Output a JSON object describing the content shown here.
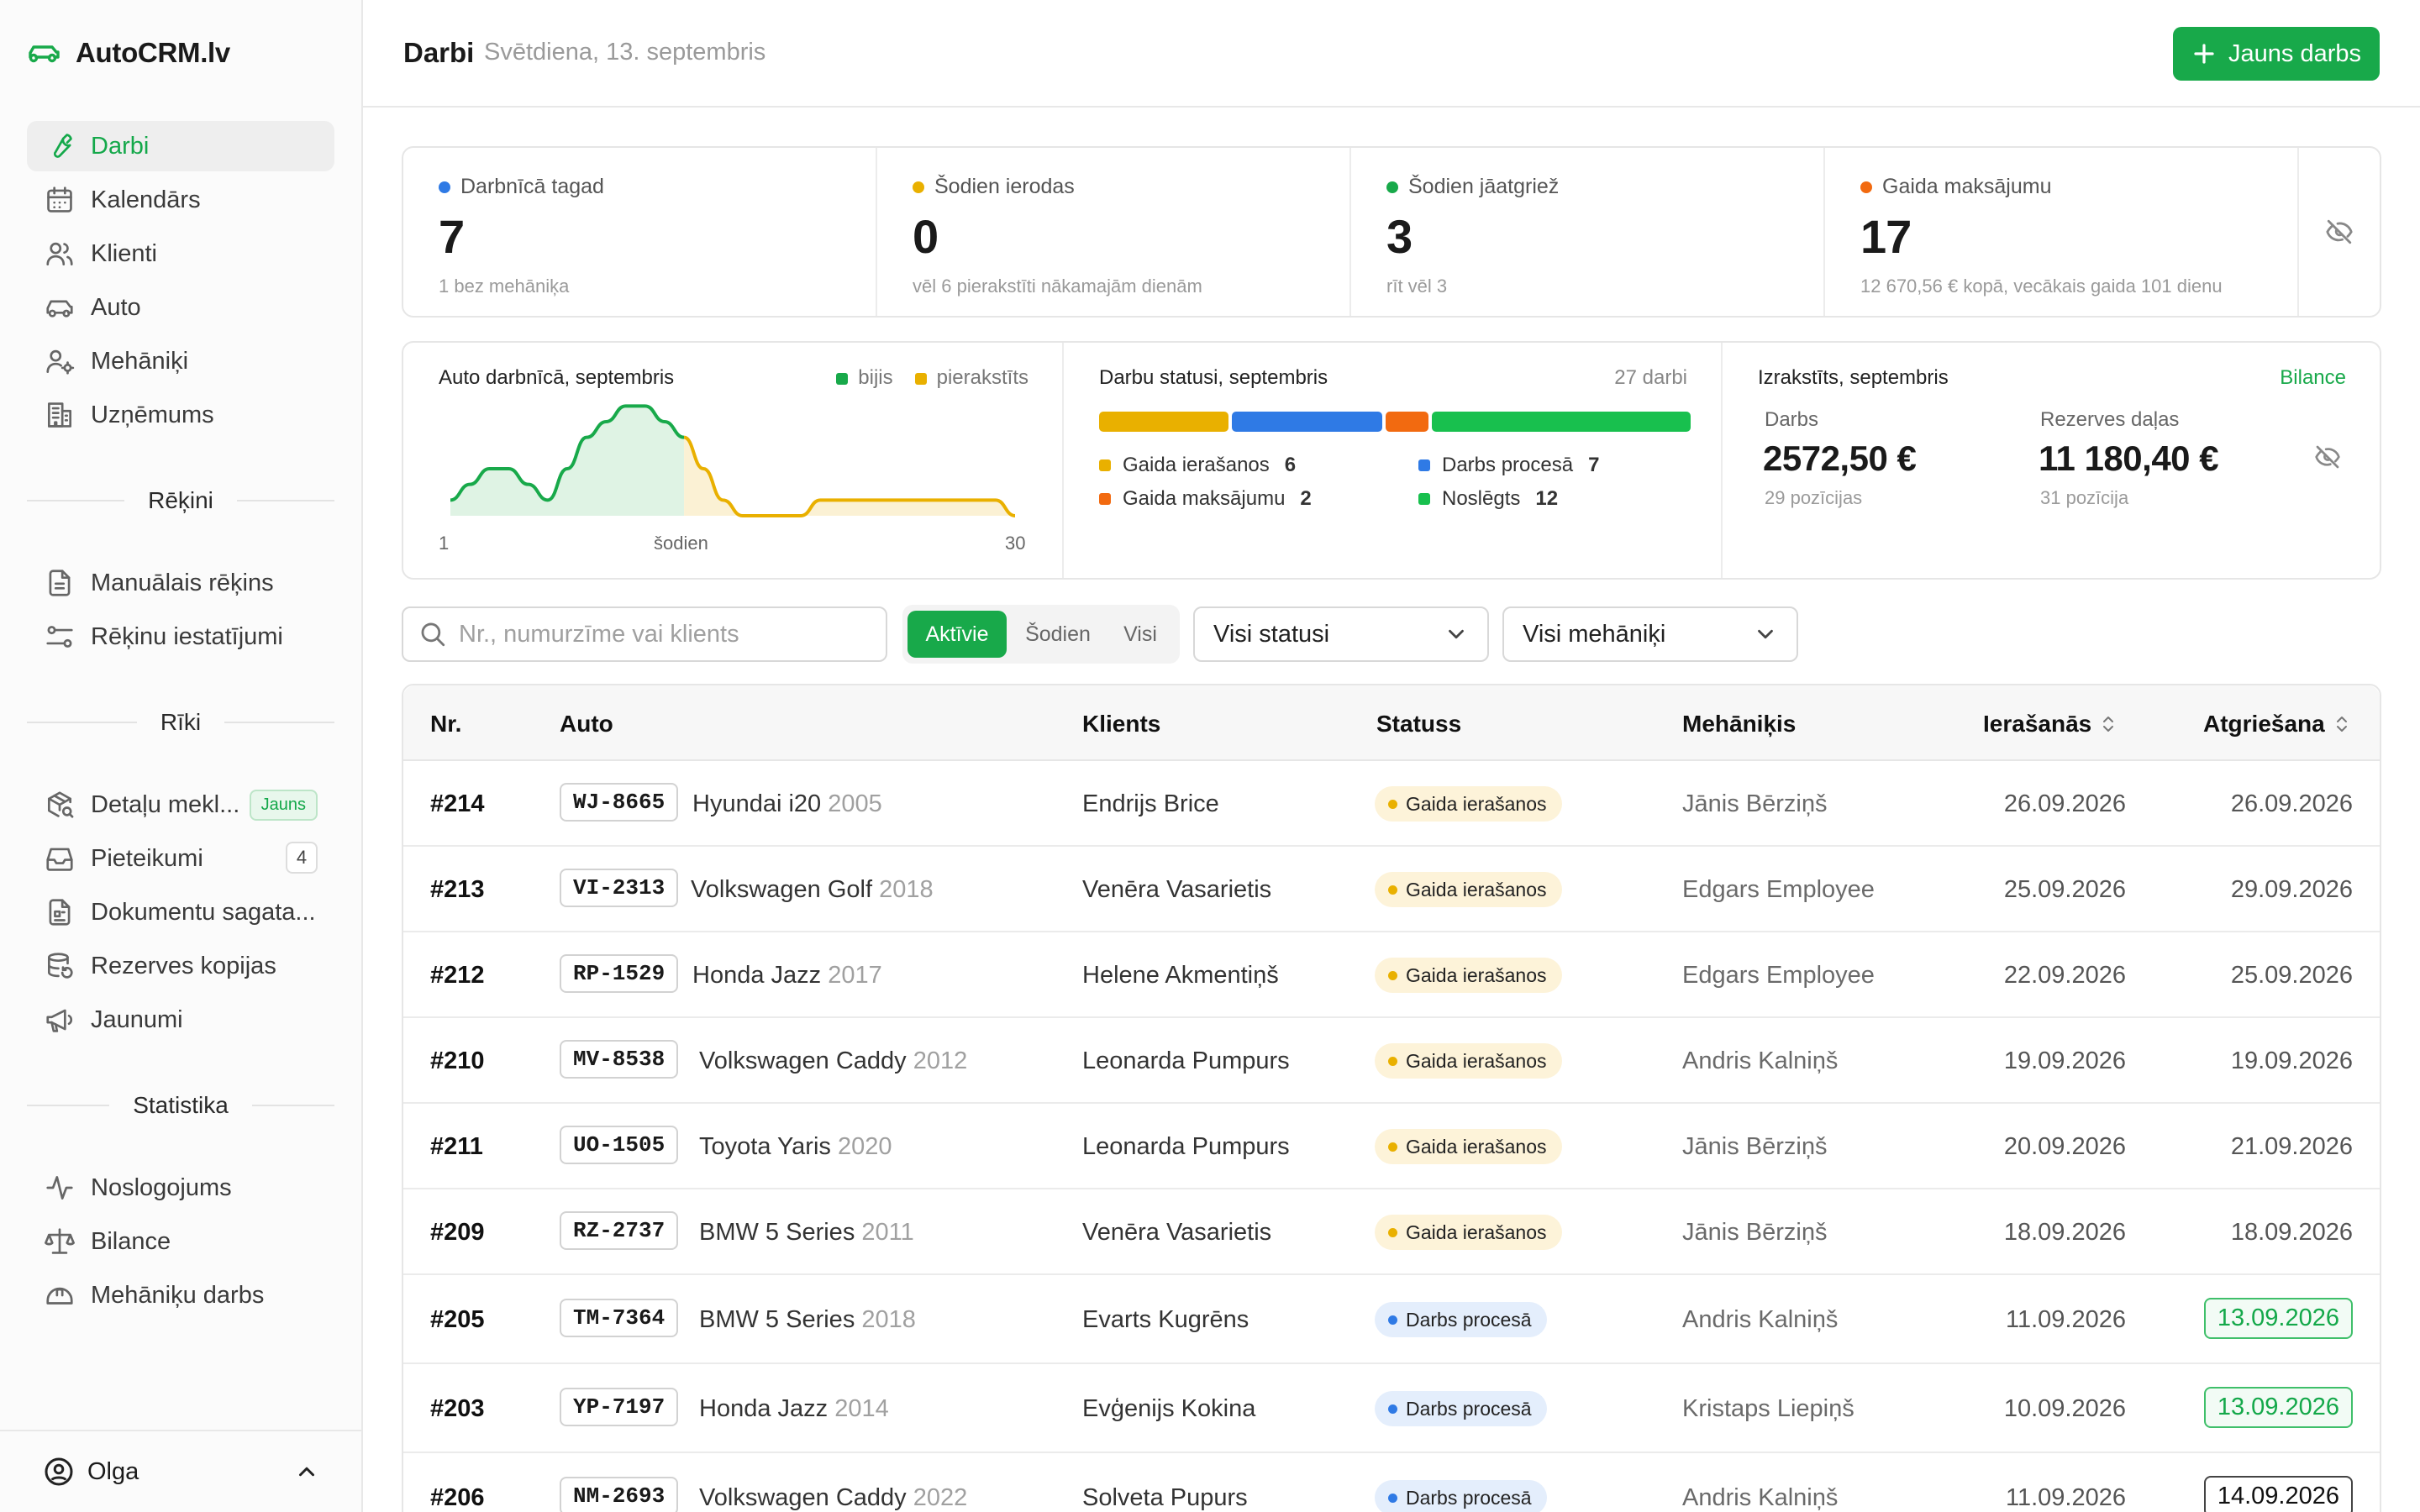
{
  "app": {
    "brand": "AutoCRM.lv"
  },
  "sidebar": {
    "main": [
      {
        "label": "Darbi",
        "icon": "wrench-icon",
        "active": true
      },
      {
        "label": "Kalendārs",
        "icon": "calendar-icon"
      },
      {
        "label": "Klienti",
        "icon": "users-icon"
      },
      {
        "label": "Auto",
        "icon": "car-icon"
      },
      {
        "label": "Mehāniķi",
        "icon": "mechanic-icon"
      },
      {
        "label": "Uzņēmums",
        "icon": "building-icon"
      }
    ],
    "sec_invoices": "Rēķini",
    "invoices": [
      {
        "label": "Manuālais rēķins",
        "icon": "document-icon"
      },
      {
        "label": "Rēķinu iestatījumi",
        "icon": "sliders-icon"
      }
    ],
    "sec_tools": "Rīki",
    "tools": [
      {
        "label": "Detaļu mekl...",
        "icon": "package-search-icon",
        "badge": "Jauns"
      },
      {
        "label": "Pieteikumi",
        "icon": "inbox-icon",
        "count": "4"
      },
      {
        "label": "Dokumentu sagata...",
        "icon": "file-template-icon"
      },
      {
        "label": "Rezerves kopijas",
        "icon": "database-backup-icon"
      },
      {
        "label": "Jaunumi",
        "icon": "megaphone-icon"
      }
    ],
    "sec_stats": "Statistika",
    "stats": [
      {
        "label": "Noslogojums",
        "icon": "activity-icon"
      },
      {
        "label": "Bilance",
        "icon": "scale-icon"
      },
      {
        "label": "Mehāniķu darbs",
        "icon": "helmet-icon"
      }
    ],
    "user": "Olga"
  },
  "header": {
    "title": "Darbi",
    "date": "Svētdiena, 13. septembris",
    "new_button": "Jauns darbs"
  },
  "stats": [
    {
      "label": "Darbnīcā tagad",
      "value": "7",
      "sub": "1 bez mehāniķa",
      "color": "#2f7ae5"
    },
    {
      "label": "Šodien ierodas",
      "value": "0",
      "sub": "vēl 6 pierakstīti nākamajām dienām",
      "color": "#e9b000"
    },
    {
      "label": "Šodien jāatgriež",
      "value": "3",
      "sub": "rīt vēl 3",
      "color": "#18a94a"
    },
    {
      "label": "Gaida maksājumu",
      "value": "17",
      "sub": "12 670,56 € kopā, vecākais gaida 101 dienu",
      "color": "#f26a10"
    }
  ],
  "chart_data": {
    "type": "area",
    "title": "Auto darbnīcā, septembris",
    "x_start_label": "1",
    "x_today_label": "šodien",
    "x_end_label": "30",
    "series": [
      {
        "name": "bijis",
        "color": "#18a94a",
        "x": [
          1,
          2,
          3,
          4,
          5,
          6,
          7,
          8,
          9,
          10,
          11,
          12,
          13
        ],
        "values": [
          1,
          2,
          3,
          3,
          2,
          1,
          3,
          5,
          6,
          7,
          7,
          6,
          5
        ]
      },
      {
        "name": "pierakstīts",
        "color": "#e9b000",
        "x": [
          13,
          14,
          15,
          16,
          17,
          18,
          19,
          20,
          21,
          22,
          23,
          24,
          25,
          26,
          27,
          28,
          29,
          30
        ],
        "values": [
          5,
          3,
          1,
          0,
          0,
          0,
          0,
          1,
          1,
          1,
          1,
          1,
          1,
          1,
          1,
          1,
          1,
          0
        ]
      }
    ],
    "ylim": [
      0,
      7.5
    ]
  },
  "status_panel": {
    "title": "Darbu statusi, septembris",
    "total": "27 darbi",
    "items": [
      {
        "label": "Gaida ierašanos",
        "count": "6",
        "value": 6,
        "color": "#e9b000"
      },
      {
        "label": "Darbs procesā",
        "count": "7",
        "value": 7,
        "color": "#2f7ae5"
      },
      {
        "label": "Gaida maksājumu",
        "count": "2",
        "value": 2,
        "color": "#f26a10"
      },
      {
        "label": "Noslēgts",
        "count": "12",
        "value": 12,
        "color": "#18c04e"
      }
    ]
  },
  "balance_panel": {
    "title": "Izrakstīts, septembris",
    "link": "Bilance",
    "work_label": "Darbs",
    "work_value": "2572,50 €",
    "work_sub": "29 pozīcijas",
    "parts_label": "Rezerves daļas",
    "parts_value": "11 180,40 €",
    "parts_sub": "31 pozīcija"
  },
  "filters": {
    "search_placeholder": "Nr., numurzīme vai klients",
    "tabs": [
      "Aktīvie",
      "Šodien",
      "Visi"
    ],
    "status_select": "Visi statusi",
    "mechanic_select": "Visi mehāniķi"
  },
  "table": {
    "headers": {
      "nr": "Nr.",
      "auto": "Auto",
      "client": "Klients",
      "status": "Statuss",
      "mechanic": "Mehāniķis",
      "arrival": "Ierašanās",
      "return": "Atgriešana"
    },
    "rows": [
      {
        "nr": "#214",
        "plate": "WJ-8665",
        "model": "Hyundai i20",
        "year": "2005",
        "client": "Endrijs Brice",
        "status": "Gaida ierašanos",
        "mechanic": "Jānis Bērziņš",
        "arrival": "26.09.2026",
        "return": "26.09.2026",
        "return_style": "plain"
      },
      {
        "nr": "#213",
        "plate": "VI-2313",
        "model": "Volkswagen Golf",
        "year": "2018",
        "client": "Venēra Vasarietis",
        "status": "Gaida ierašanos",
        "mechanic": "Edgars Employee",
        "arrival": "25.09.2026",
        "return": "29.09.2026",
        "return_style": "plain"
      },
      {
        "nr": "#212",
        "plate": "RP-1529",
        "model": "Honda Jazz",
        "year": "2017",
        "client": "Helene Akmentiņš",
        "status": "Gaida ierašanos",
        "mechanic": "Edgars Employee",
        "arrival": "22.09.2026",
        "return": "25.09.2026",
        "return_style": "plain"
      },
      {
        "nr": "#210",
        "plate": "MV-8538",
        "model": "Volkswagen Caddy",
        "year": "2012",
        "client": "Leonarda Pumpurs",
        "status": "Gaida ierašanos",
        "mechanic": "Andris Kalniņš",
        "arrival": "19.09.2026",
        "return": "19.09.2026",
        "return_style": "plain"
      },
      {
        "nr": "#211",
        "plate": "UO-1505",
        "model": "Toyota Yaris",
        "year": "2020",
        "client": "Leonarda Pumpurs",
        "status": "Gaida ierašanos",
        "mechanic": "Jānis Bērziņš",
        "arrival": "20.09.2026",
        "return": "21.09.2026",
        "return_style": "plain"
      },
      {
        "nr": "#209",
        "plate": "RZ-2737",
        "model": "BMW 5 Series",
        "year": "2011",
        "client": "Venēra Vasarietis",
        "status": "Gaida ierašanos",
        "mechanic": "Jānis Bērziņš",
        "arrival": "18.09.2026",
        "return": "18.09.2026",
        "return_style": "plain"
      },
      {
        "nr": "#205",
        "plate": "TM-7364",
        "model": "BMW 5 Series",
        "year": "2018",
        "client": "Evarts Kugrēns",
        "status": "Darbs procesā",
        "mechanic": "Andris Kalniņš",
        "arrival": "11.09.2026",
        "return": "13.09.2026",
        "return_style": "green"
      },
      {
        "nr": "#203",
        "plate": "YP-7197",
        "model": "Honda Jazz",
        "year": "2014",
        "client": "Evģenijs Kokina",
        "status": "Darbs procesā",
        "mechanic": "Kristaps Liepiņš",
        "arrival": "10.09.2026",
        "return": "13.09.2026",
        "return_style": "green"
      },
      {
        "nr": "#206",
        "plate": "NM-2693",
        "model": "Volkswagen Caddy",
        "year": "2022",
        "client": "Solveta Pupurs",
        "status": "Darbs procesā",
        "mechanic": "Andris Kalniņš",
        "arrival": "11.09.2026",
        "return": "14.09.2026",
        "return_style": "grey"
      }
    ]
  }
}
